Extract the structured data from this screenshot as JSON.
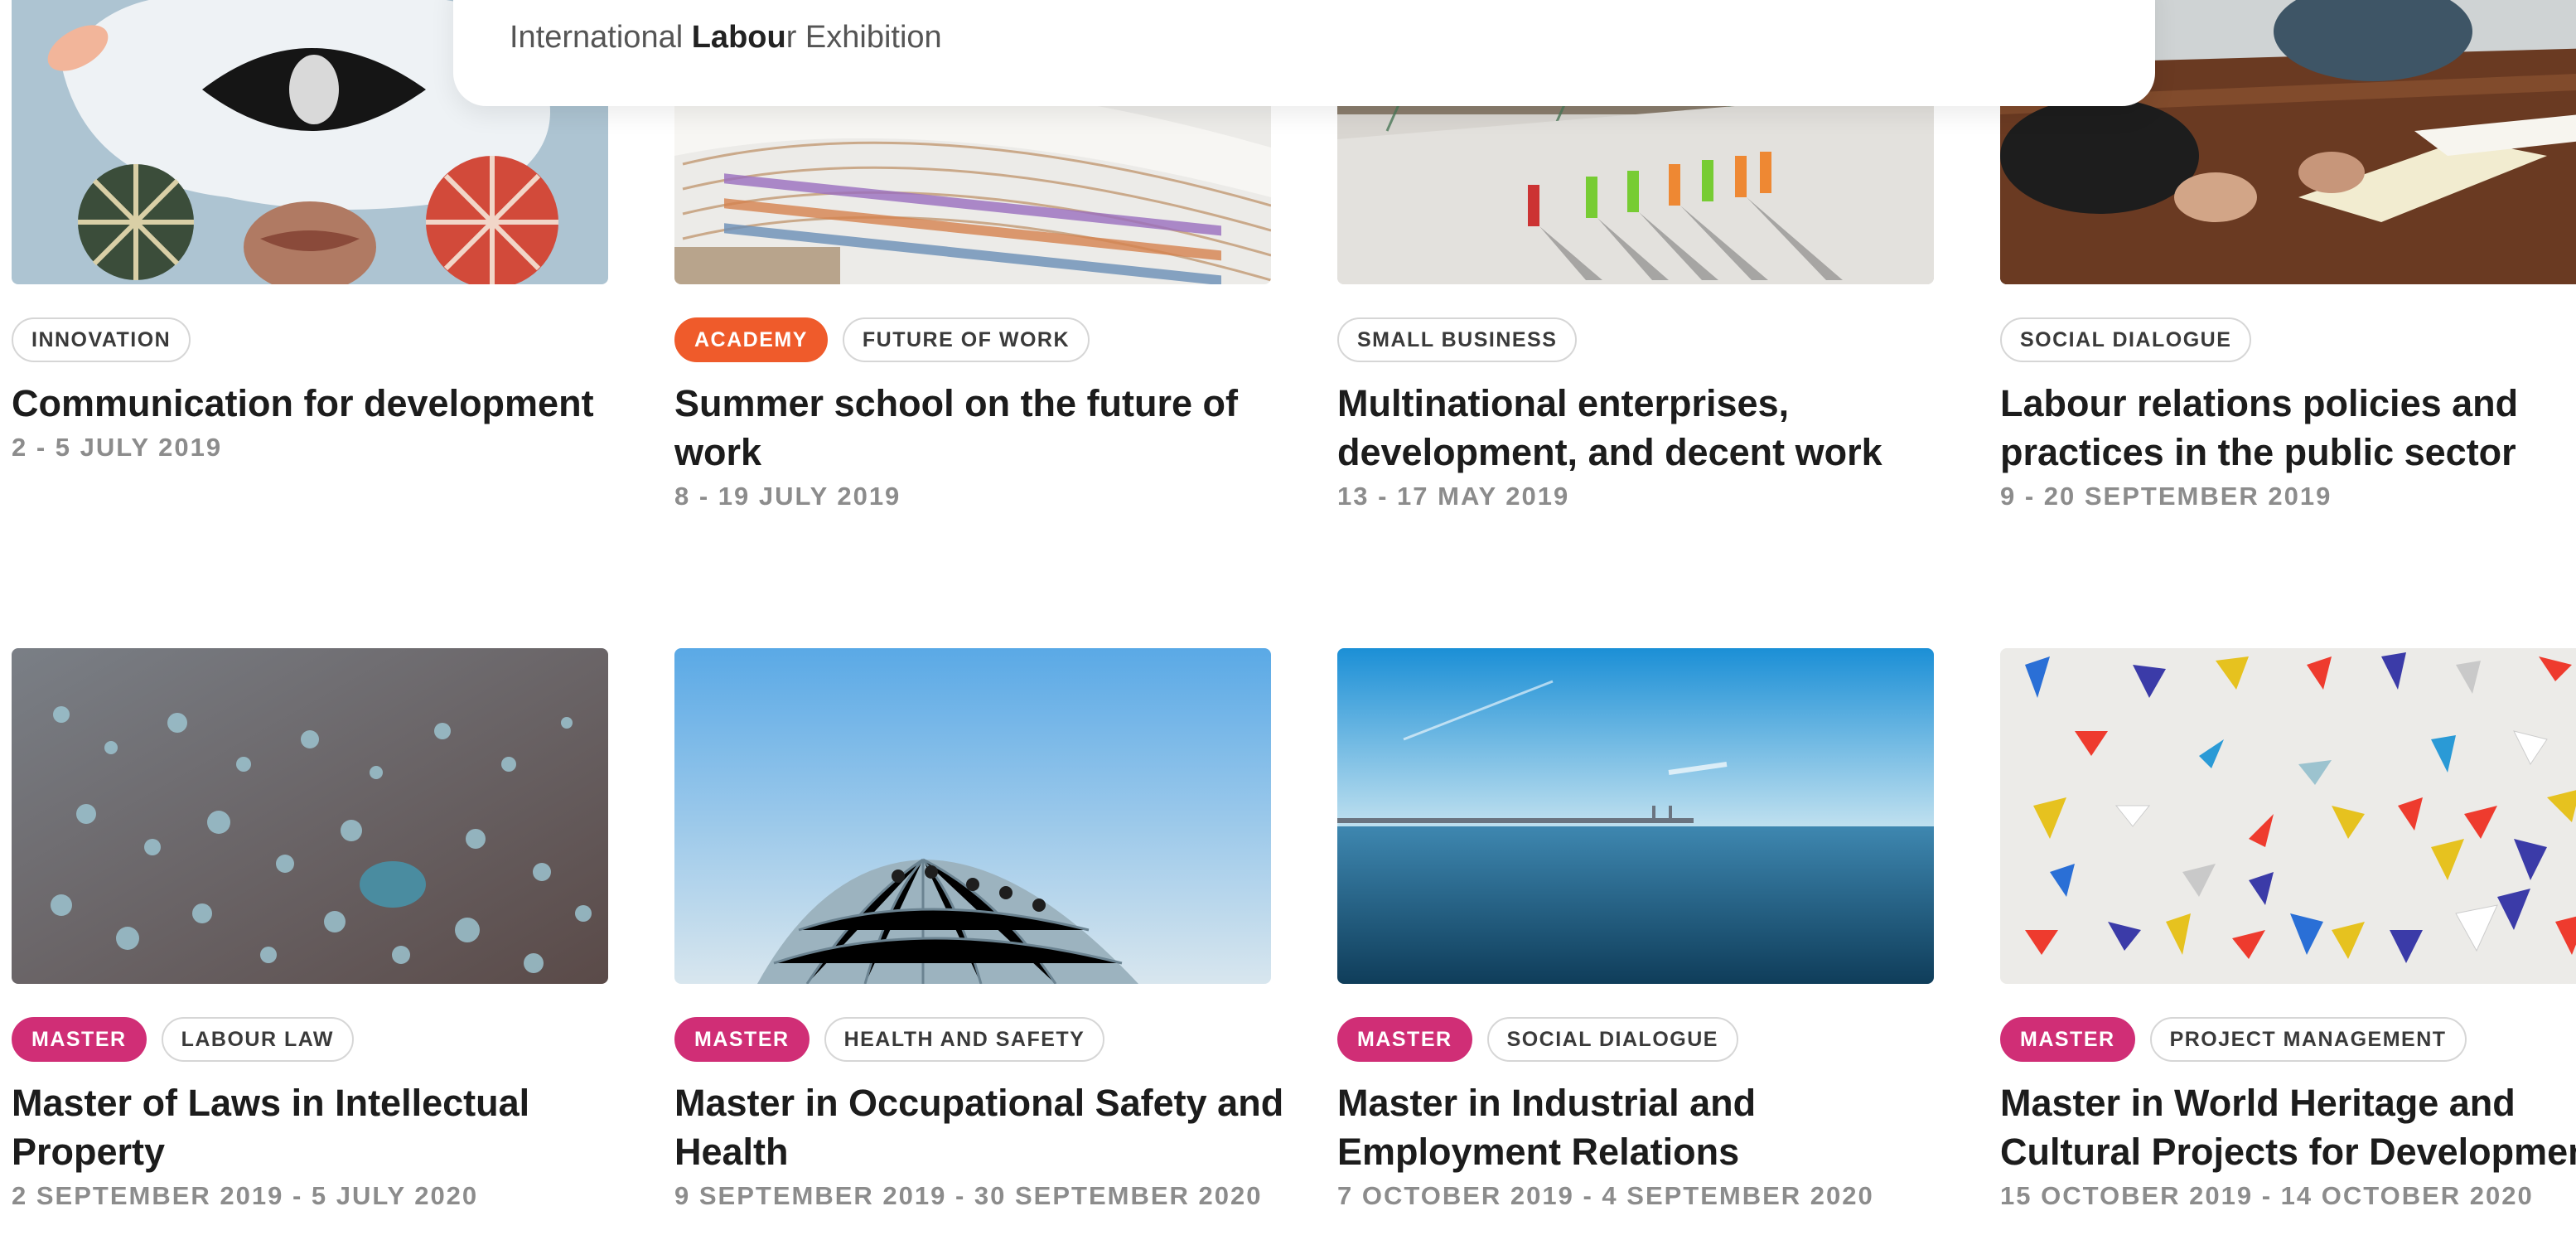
{
  "header": {
    "brand_prefix": "International ",
    "brand_bold": "Labou",
    "brand_suffix": "r Exhibition"
  },
  "courses": [
    {
      "tags": [
        {
          "label": "INNOVATION",
          "kind": "plain"
        }
      ],
      "title": "Communication for development",
      "date": "2 - 5 JULY 2019",
      "image": "collage-eye"
    },
    {
      "tags": [
        {
          "label": "ACADEMY",
          "kind": "academy"
        },
        {
          "label": "FUTURE OF WORK",
          "kind": "plain"
        }
      ],
      "title": "Summer school on the future of work",
      "date": "8 - 19 JULY 2019",
      "image": "library-shelves"
    },
    {
      "tags": [
        {
          "label": "SMALL BUSINESS",
          "kind": "plain"
        }
      ],
      "title": "Multinational enterprises, development, and decent work",
      "date": "13 - 17 MAY 2019",
      "image": "construction-workers"
    },
    {
      "tags": [
        {
          "label": "SOCIAL DIALOGUE",
          "kind": "plain"
        }
      ],
      "title": "Labour relations policies and practices in the public sector",
      "date": "9 - 20 SEPTEMBER 2019",
      "image": "meeting-table"
    },
    {
      "tags": [
        {
          "label": "MASTER",
          "kind": "master"
        },
        {
          "label": "LABOUR LAW",
          "kind": "plain"
        }
      ],
      "title": "Master of Laws in Intellectual Property",
      "date": "2 SEPTEMBER 2019 - 5 JULY 2020",
      "image": "water-droplets"
    },
    {
      "tags": [
        {
          "label": "MASTER",
          "kind": "master"
        },
        {
          "label": "HEALTH AND SAFETY",
          "kind": "plain"
        }
      ],
      "title": "Master in Occupational Safety and Health",
      "date": "9 SEPTEMBER 2019 - 30 SEPTEMBER 2020",
      "image": "dome-climbers"
    },
    {
      "tags": [
        {
          "label": "MASTER",
          "kind": "master"
        },
        {
          "label": "SOCIAL DIALOGUE",
          "kind": "plain"
        }
      ],
      "title": "Master in Industrial and Employment Relations",
      "date": "7 OCTOBER 2019 - 4 SEPTEMBER 2020",
      "image": "sea-bridge"
    },
    {
      "tags": [
        {
          "label": "MASTER",
          "kind": "master"
        },
        {
          "label": "PROJECT MANAGEMENT",
          "kind": "plain"
        }
      ],
      "title": "Master in World Heritage and Cultural Projects for Development",
      "date": "15 OCTOBER 2019 - 14 OCTOBER 2020",
      "image": "paper-triangles"
    }
  ],
  "colors": {
    "academy": "#ef5b2b",
    "master": "#d02e76",
    "date": "#8c8c8c"
  }
}
